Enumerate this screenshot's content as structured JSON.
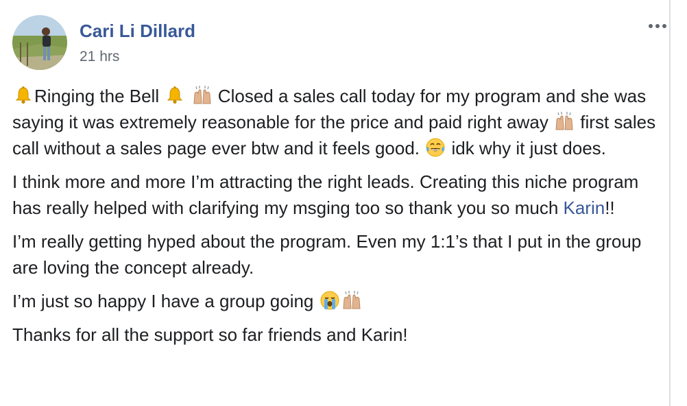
{
  "post": {
    "author": "Cari Li Dillard",
    "timestamp": "21 hrs",
    "more_icon": "ellipsis-icon",
    "p1": {
      "a": "Ringing the Bell ",
      "b": " Closed a sales call today for my program and she was saying it was extremely reasonable for the price and paid right away ",
      "c": " first sales call without a sales page ever btw and it feels good. ",
      "d": " idk why it just does."
    },
    "p2": {
      "a": "I think more and more I’m attracting the right leads. Creating this niche program has really helped with clarifying my msging too so thank you so much ",
      "mention": "Karin",
      "b": "!!"
    },
    "p3": "I’m really getting hyped about the program. Even my 1:1’s that I put in the group are loving the concept already.",
    "p4": "I’m just so happy I have a group going ",
    "p5": "Thanks for all the support so far friends and Karin!",
    "emoji_icons": [
      "bell-icon",
      "raising-hands-icon",
      "tears-of-joy-icon",
      "loudly-crying-icon"
    ]
  }
}
